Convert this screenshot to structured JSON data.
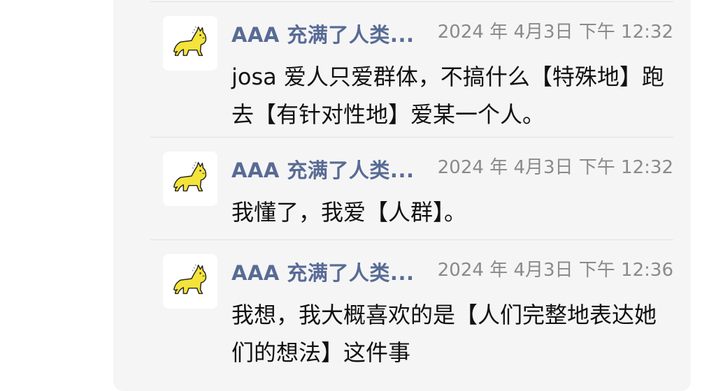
{
  "messages": [
    {
      "sender": "AAA 充满了人类...",
      "time": "2024 年 4月3日  下午 12:32",
      "text": "josa 爱人只爱群体，不搞什么【特殊地】跑去【有针对性地】爱某一个人。",
      "avatar_icon": "yellow-cat-icon"
    },
    {
      "sender": "AAA 充满了人类...",
      "time": "2024 年 4月3日  下午 12:32",
      "text": "我懂了，我爱【人群】。",
      "avatar_icon": "yellow-cat-icon"
    },
    {
      "sender": "AAA 充满了人类...",
      "time": "2024 年 4月3日  下午 12:36",
      "text": "我想，我大概喜欢的是【人们完整地表达她们的想法】这件事",
      "avatar_icon": "yellow-cat-icon"
    }
  ],
  "colors": {
    "sender": "#586b95",
    "time": "#8a8a8a",
    "panel": "#f5f5f5",
    "cat": "#f4e33a"
  }
}
